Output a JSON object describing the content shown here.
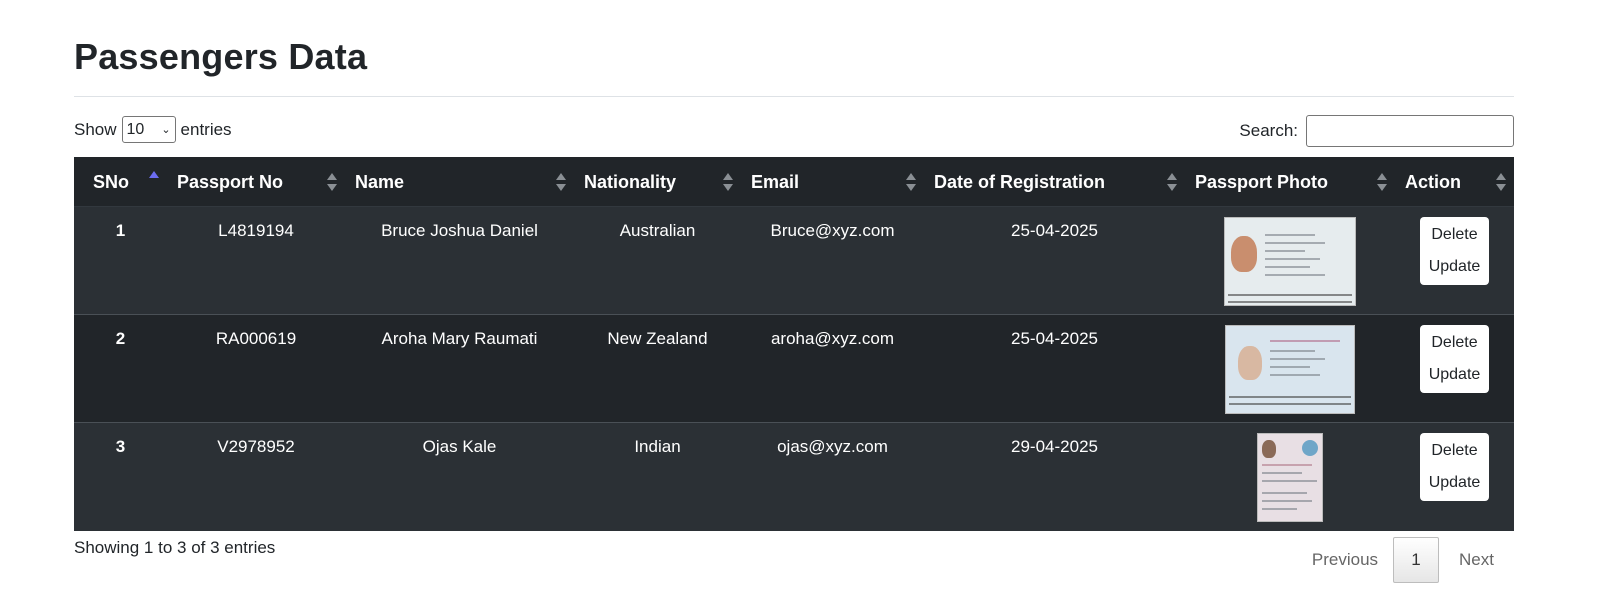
{
  "page": {
    "title": "Passengers Data"
  },
  "length": {
    "show_label": "Show",
    "selected": "10",
    "entries_label": "entries"
  },
  "search": {
    "label": "Search:",
    "value": ""
  },
  "table": {
    "columns": [
      "SNo",
      "Passport No",
      "Name",
      "Nationality",
      "Email",
      "Date of Registration",
      "Passport Photo",
      "Action"
    ],
    "sort": {
      "column": "SNo",
      "direction": "ascending"
    },
    "rows": [
      {
        "sno": "1",
        "passport_no": "L4819194",
        "name": "Bruce Joshua Daniel",
        "nationality": "Australian",
        "email": "Bruce@xyz.com",
        "date": "25-04-2025",
        "delete_label": "Delete",
        "update_label": "Update"
      },
      {
        "sno": "2",
        "passport_no": "RA000619",
        "name": "Aroha Mary Raumati",
        "nationality": "New Zealand",
        "email": "aroha@xyz.com",
        "date": "25-04-2025",
        "delete_label": "Delete",
        "update_label": "Update"
      },
      {
        "sno": "3",
        "passport_no": "V2978952",
        "name": "Ojas Kale",
        "nationality": "Indian",
        "email": "ojas@xyz.com",
        "date": "29-04-2025",
        "delete_label": "Delete",
        "update_label": "Update"
      }
    ]
  },
  "footer": {
    "info": "Showing 1 to 3 of 3 entries",
    "previous_label": "Previous",
    "current_page": "1",
    "next_label": "Next"
  },
  "colors": {
    "header_bg": "#212529",
    "row_odd": "#2b3035",
    "row_even": "#212529",
    "sort_active": "#6c6cf0"
  }
}
